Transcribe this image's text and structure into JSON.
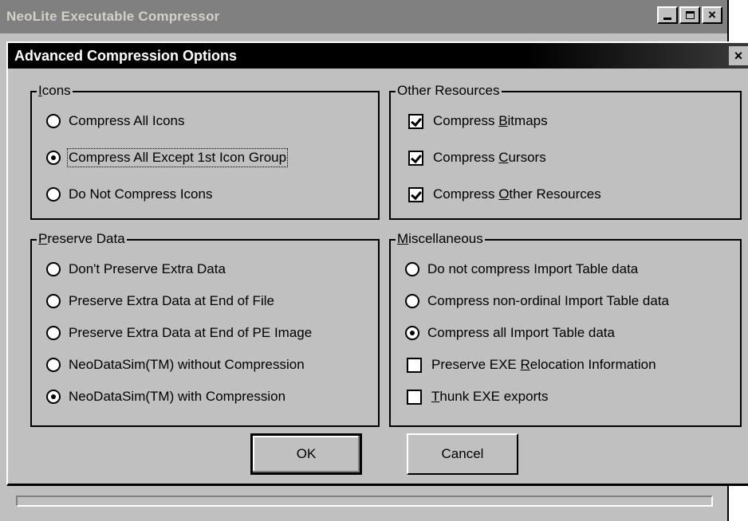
{
  "parent_window": {
    "title": "NeoLite Executable Compressor",
    "buttons": {
      "minimize_icon": "minimize-icon",
      "maximize_icon": "maximize-icon",
      "close_label": "×"
    }
  },
  "dialog": {
    "title": "Advanced Compression Options",
    "close_label": "×",
    "icons_group": {
      "legend_key": "I",
      "legend_rest": "cons",
      "options": [
        {
          "label": "Compress All Icons",
          "checked": false
        },
        {
          "label": "Compress All Except 1st Icon Group",
          "checked": true
        },
        {
          "label": "Do Not Compress Icons",
          "checked": false
        }
      ]
    },
    "other_resources_group": {
      "legend": "Other Resources",
      "options": [
        {
          "pre": "Compress ",
          "key": "B",
          "post": "itmaps",
          "checked": true
        },
        {
          "pre": "Compress ",
          "key": "C",
          "post": "ursors",
          "checked": true
        },
        {
          "pre": "Compress ",
          "key": "O",
          "post": "ther Resources",
          "checked": true
        }
      ]
    },
    "preserve_data_group": {
      "legend_key": "P",
      "legend_rest": "reserve Data",
      "options": [
        {
          "label": "Don't Preserve Extra Data",
          "checked": false
        },
        {
          "label": "Preserve Extra Data at End of File",
          "checked": false
        },
        {
          "label": "Preserve Extra Data at End of PE Image",
          "checked": false
        },
        {
          "label": "NeoDataSim(TM) without Compression",
          "checked": false
        },
        {
          "label": "NeoDataSim(TM) with Compression",
          "checked": true
        }
      ]
    },
    "misc_group": {
      "legend_key": "M",
      "legend_rest": "iscellaneous",
      "radios": [
        {
          "label": "Do not compress Import Table data",
          "checked": false
        },
        {
          "label": "Compress non-ordinal Import Table data",
          "checked": false
        },
        {
          "label": "Compress all Import Table data",
          "checked": true
        }
      ],
      "checks": [
        {
          "pre": "Preserve EXE ",
          "key": "R",
          "post": "elocation Information",
          "checked": false
        },
        {
          "pre": "",
          "key": "T",
          "post": "hunk EXE exports",
          "checked": false
        }
      ]
    },
    "ok_label": "OK",
    "cancel_label": "Cancel"
  }
}
